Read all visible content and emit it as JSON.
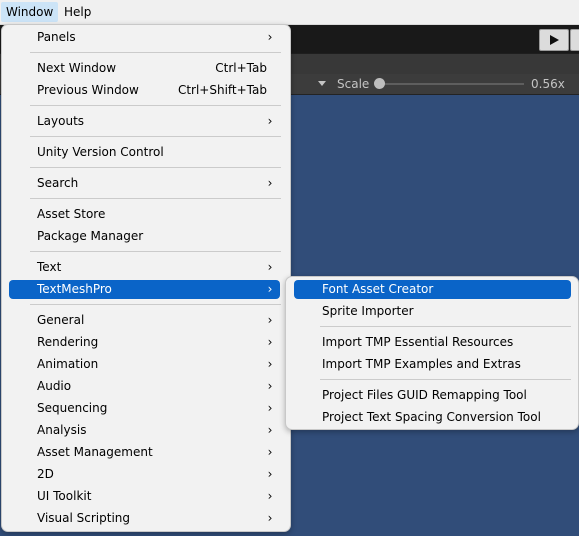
{
  "menubar": {
    "items": [
      {
        "label": "Window"
      },
      {
        "label": "Help"
      }
    ]
  },
  "scene_toolbar": {
    "scale_label": "Scale",
    "scale_value": "0.56x"
  },
  "window_menu": {
    "items": [
      {
        "label": "Panels",
        "submenu": true
      },
      {
        "label": "Next Window",
        "shortcut": "Ctrl+Tab"
      },
      {
        "label": "Previous Window",
        "shortcut": "Ctrl+Shift+Tab"
      },
      {
        "label": "Layouts",
        "submenu": true
      },
      {
        "label": "Unity Version Control"
      },
      {
        "label": "Search",
        "submenu": true
      },
      {
        "label": "Asset Store"
      },
      {
        "label": "Package Manager"
      },
      {
        "label": "Text",
        "submenu": true
      },
      {
        "label": "TextMeshPro",
        "submenu": true,
        "selected": true
      },
      {
        "label": "General",
        "submenu": true
      },
      {
        "label": "Rendering",
        "submenu": true
      },
      {
        "label": "Animation",
        "submenu": true
      },
      {
        "label": "Audio",
        "submenu": true
      },
      {
        "label": "Sequencing",
        "submenu": true
      },
      {
        "label": "Analysis",
        "submenu": true
      },
      {
        "label": "Asset Management",
        "submenu": true
      },
      {
        "label": "2D",
        "submenu": true
      },
      {
        "label": "UI Toolkit",
        "submenu": true
      },
      {
        "label": "Visual Scripting",
        "submenu": true
      }
    ],
    "submenu_arrow": "›"
  },
  "textmeshpro_submenu": {
    "items": [
      {
        "label": "Font Asset Creator",
        "selected": true
      },
      {
        "label": "Sprite Importer"
      },
      {
        "label": "Import TMP Essential Resources"
      },
      {
        "label": "Import TMP Examples and Extras"
      },
      {
        "label": "Project Files GUID Remapping Tool"
      },
      {
        "label": "Project Text Spacing Conversion Tool"
      }
    ]
  },
  "colors": {
    "highlight": "#0a64c8",
    "game_view_bg": "#314d79",
    "menu_bg": "#f2f2f2"
  },
  "icons": {
    "play": "play-icon",
    "submenu": "chevron-right-icon"
  }
}
